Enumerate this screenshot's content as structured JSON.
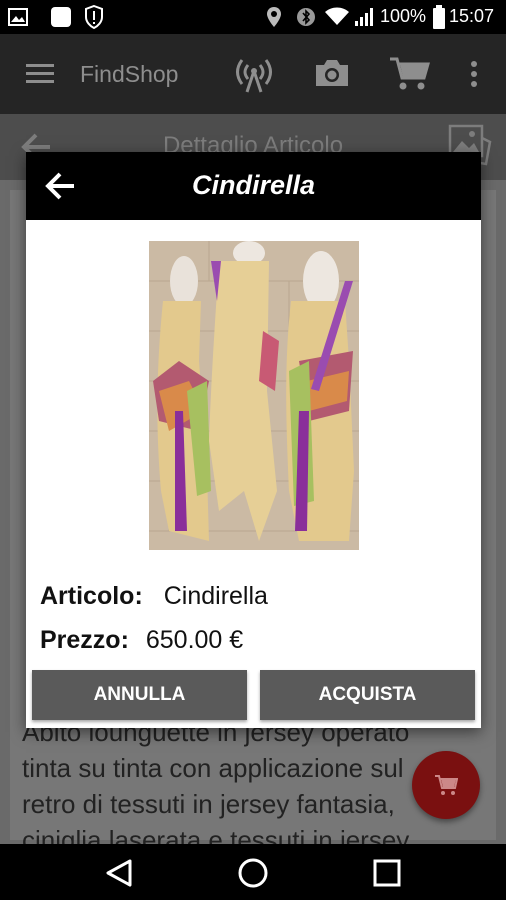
{
  "status_bar": {
    "battery_percent": "100%",
    "time": "15:07",
    "icons": [
      "image-icon",
      "square-icon",
      "shield-alert-icon",
      "location-icon",
      "bluetooth-icon",
      "wifi-icon",
      "signal-icon",
      "battery-icon"
    ]
  },
  "app_bar": {
    "title": "FindShop",
    "icons": [
      "menu-icon",
      "antenna-icon",
      "camera-icon",
      "cart-icon",
      "overflow-menu-icon"
    ]
  },
  "sub_bar": {
    "title": "Dettaglio Articolo",
    "icons": [
      "back-arrow-icon",
      "gallery-icon"
    ]
  },
  "description": {
    "lines": [
      "Abito lounguette in jersey operato",
      "tinta su tinta con applicazione sul",
      "retro di tessuti in jersey fantasia,",
      "ciniglia laserata e tessuti in jersey"
    ]
  },
  "fab": {
    "icon": "cart-icon",
    "color": "#7a1010"
  },
  "dialog": {
    "title": "Cindirella",
    "article_label": "Articolo:",
    "article_value": "Cindirella",
    "price_label": "Prezzo:",
    "price_value": "650.00 €",
    "cancel_label": "ANNULLA",
    "buy_label": "ACQUISTA",
    "button_color": "#5a5a5a"
  },
  "nav_bar": {
    "icons": [
      "back-triangle-icon",
      "home-circle-icon",
      "recents-square-icon"
    ]
  }
}
